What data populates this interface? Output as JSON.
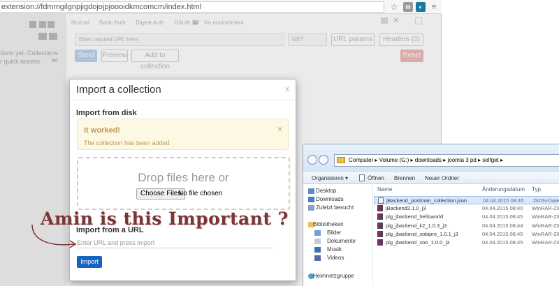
{
  "browser": {
    "url": "extension://fdmmgilgnpjigdojojpjoooidkmcomcm/index.html"
  },
  "postman": {
    "sidebar_text_1": "tions yet. Collections let",
    "sidebar_text_2": "r quick access.",
    "tabs": [
      "Normal",
      "Basic Auth",
      "Digest Auth",
      "OAuth 1.0"
    ],
    "env": "No environment",
    "url_placeholder": "Enter request URL here",
    "method": "GET",
    "url_params": "URL params",
    "headers": "Headers (0)",
    "send": "Send",
    "preview": "Preview",
    "add_to_collection": "Add to collection",
    "reset": "Reset"
  },
  "modal": {
    "title": "Import a collection",
    "close": "x",
    "from_disk": "Import from disk",
    "alert_title": "It worked!",
    "alert_message": "The collection has been added",
    "alert_close": "×",
    "drop_text": "Drop files here or",
    "choose_files": "Choose Files",
    "no_file": "No file chosen",
    "from_url": "Import from a URL",
    "url_placeholder": "Enter URL and press import",
    "import_button": "Import"
  },
  "annotation": "Amin is this Important ?",
  "explorer": {
    "breadcrumb": [
      "Computer",
      "Volume (G:)",
      "downloads",
      "joomla 3 pd",
      "selfget"
    ],
    "toolbar": [
      "Organisieren ▾",
      "Öffnen",
      "Brennen",
      "Neuer Ordner"
    ],
    "nav": [
      "Desktop",
      "Downloads",
      "Zuletzt besucht",
      "Bibliotheken",
      "Bilder",
      "Dokumente",
      "Musik",
      "Videos",
      "Heimnetzgruppe"
    ],
    "columns": [
      "Name",
      "Änderungsdatum",
      "Typ"
    ],
    "files": [
      {
        "name": "jBackend_postman_collection.json",
        "date": "04.04.2015 08:45",
        "type": "JSON-Datei",
        "selected": true,
        "icon": "json-file-icon"
      },
      {
        "name": "jBackend2.1.0_j3",
        "date": "04.04.2015 08:40",
        "type": "WinRAR-ZIP-",
        "selected": false,
        "icon": "winrar-icon"
      },
      {
        "name": "plg_jbackend_helloworld",
        "date": "04.04.2015 08:45",
        "type": "WinRAR-ZIP-",
        "selected": false,
        "icon": "winrar-icon"
      },
      {
        "name": "plg_jbackend_k2_1.0.3_j3",
        "date": "04.04.2015 08:44",
        "type": "WinRAR-ZIP-",
        "selected": false,
        "icon": "winrar-icon"
      },
      {
        "name": "plg_jbackend_sobipro_1.0.1_j3",
        "date": "04.04.2015 08:45",
        "type": "WinRAR-ZIP-",
        "selected": false,
        "icon": "winrar-icon"
      },
      {
        "name": "plg_jbackend_zoo_1.0.0_j3",
        "date": "04.04.2015 08:45",
        "type": "WinRAR-ZIP-",
        "selected": false,
        "icon": "winrar-icon"
      }
    ]
  },
  "colors": {
    "accent": "#1565c0",
    "alert_bg": "#fcf8e3",
    "annotation": "#7a3535"
  }
}
